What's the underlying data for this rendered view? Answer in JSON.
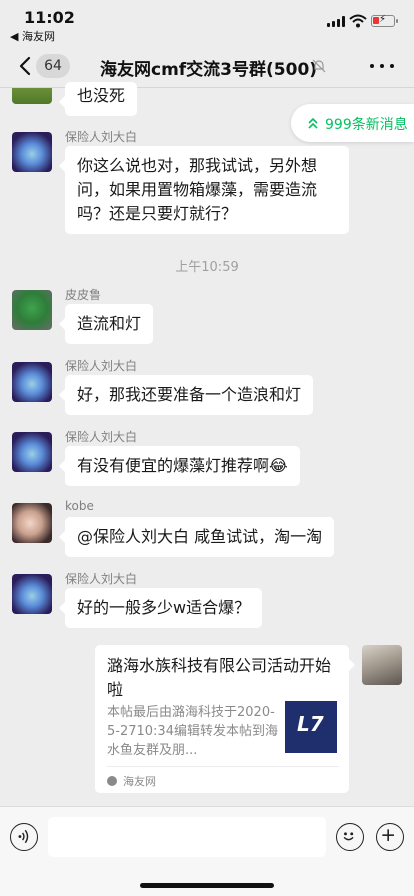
{
  "status_bar": {
    "time": "11:02",
    "back_app": "◀ 海友网"
  },
  "nav": {
    "unread_count": "64",
    "title": "海友网cmf交流3号群(500)"
  },
  "new_messages": {
    "label": "999条新消息"
  },
  "messages": [
    {
      "sender": "",
      "text": "也没死"
    },
    {
      "sender": "保险人刘大白",
      "text": "你这么说也对，那我试试，另外想问，如果用置物箱爆藻，需要造流吗？还是只要灯就行？"
    },
    {
      "sender": "皮皮鲁",
      "text": "造流和灯"
    },
    {
      "sender": "保险人刘大白",
      "text": "好，那我还要准备一个造浪和灯"
    },
    {
      "sender": "保险人刘大白",
      "text": "有没有便宜的爆藻灯推荐啊😂"
    },
    {
      "sender": "kobe",
      "text": "@保险人刘大白 咸鱼试试，淘一淘"
    },
    {
      "sender": "保险人刘大白",
      "text": "好的一般多少w适合爆？"
    }
  ],
  "time_label": "上午10:59",
  "card": {
    "title": "潞海水族科技有限公司活动开始啦",
    "desc": "本帖最后由潞海科技于2020-5-2710:34编辑转发本帖到海水鱼友群及朋...",
    "source": "海友网",
    "thumb_mark": "L7"
  },
  "colors": {
    "accent": "#07c160",
    "background": "#ededed",
    "bubble": "#ffffff"
  },
  "icons": {
    "back": "chevron-left-icon",
    "mute": "bell-off-icon",
    "more": "more-dots-icon",
    "new_msg": "double-up-arrow-icon",
    "voice": "voice-icon",
    "emoji": "emoji-icon",
    "plus": "plus-icon"
  }
}
